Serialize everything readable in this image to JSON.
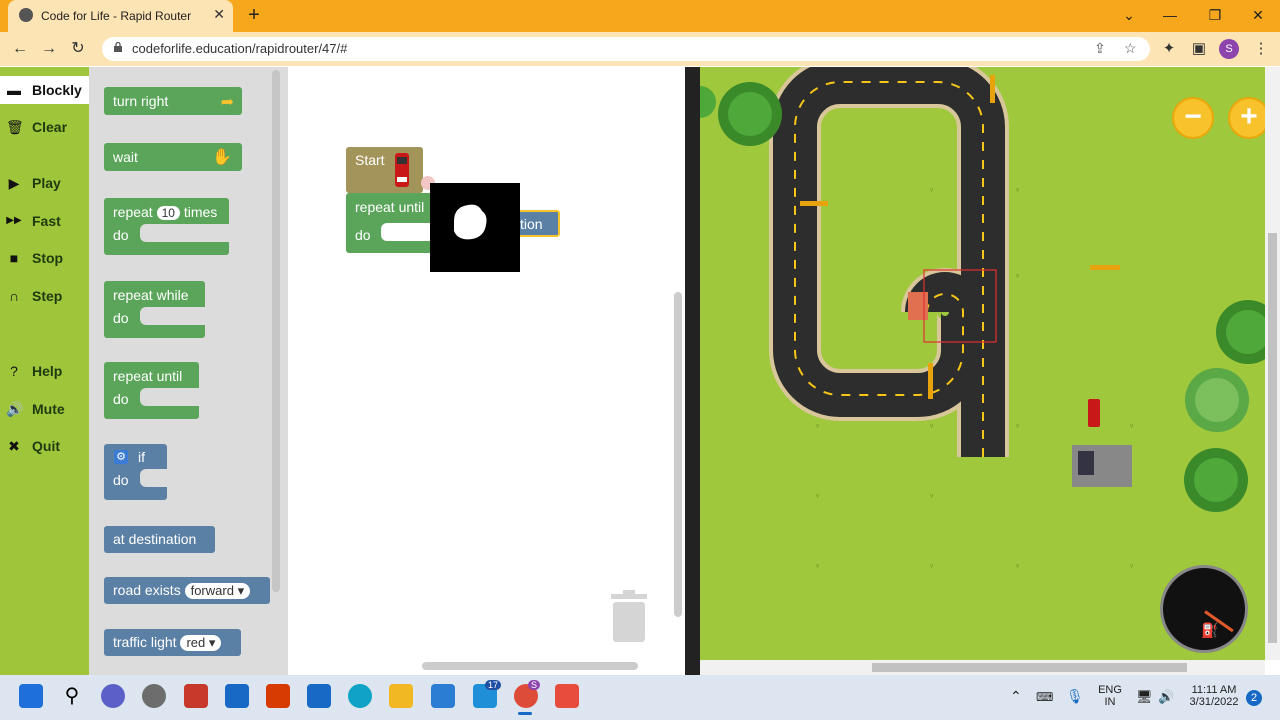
{
  "browser": {
    "tab_title": "Code for Life - Rapid Router",
    "tab_close": "✕",
    "new_tab": "+",
    "url": "codeforlife.education/rapidrouter/47/#",
    "profile_initial": "S",
    "window_controls": {
      "minimize": "⌄",
      "min": "—",
      "restore": "❐",
      "close": "✕"
    }
  },
  "menu": {
    "items": [
      {
        "label": "Blockly",
        "icon": "blockly-icon"
      },
      {
        "label": "Clear",
        "icon": "trash-icon"
      },
      {
        "label": "Play",
        "icon": "play-icon"
      },
      {
        "label": "Fast",
        "icon": "fast-forward-icon"
      },
      {
        "label": "Stop",
        "icon": "stop-icon"
      },
      {
        "label": "Step",
        "icon": "step-icon"
      },
      {
        "label": "Help",
        "icon": "help-icon"
      },
      {
        "label": "Mute",
        "icon": "speaker-icon"
      },
      {
        "label": "Quit",
        "icon": "close-icon"
      }
    ]
  },
  "toolbox": {
    "turn_right": "turn right",
    "wait": "wait",
    "repeat_times": {
      "prefix": "repeat",
      "count": "10",
      "suffix": "times",
      "do": "do"
    },
    "repeat_while": {
      "label": "repeat while",
      "do": "do"
    },
    "repeat_until": {
      "label": "repeat until",
      "do": "do"
    },
    "if_block": {
      "label": "if",
      "do": "do"
    },
    "at_destination": "at destination",
    "road_exists": {
      "label": "road exists",
      "option": "forward"
    },
    "traffic_light": {
      "label": "traffic light",
      "option": "red"
    }
  },
  "workspace": {
    "start_label": "Start",
    "repeat_until_label": "repeat until",
    "do_label": "do",
    "dragged_partial": "tion"
  },
  "game": {
    "zoom_out": "−",
    "zoom_in": "+"
  },
  "taskbar": {
    "language": "ENG",
    "region": "IN",
    "time": "11:11 AM",
    "date": "3/31/2022",
    "notifications": "2",
    "mail_badge": "17",
    "chrome_badge": "S"
  },
  "colors": {
    "chrome": "#f7a71c",
    "menu_green": "#9fc63a",
    "block_green": "#5ba55b",
    "block_blue": "#5b80a5",
    "start_block": "#a3955a",
    "grass": "#9fc83c",
    "zoom_yellow": "#f8c22c"
  }
}
